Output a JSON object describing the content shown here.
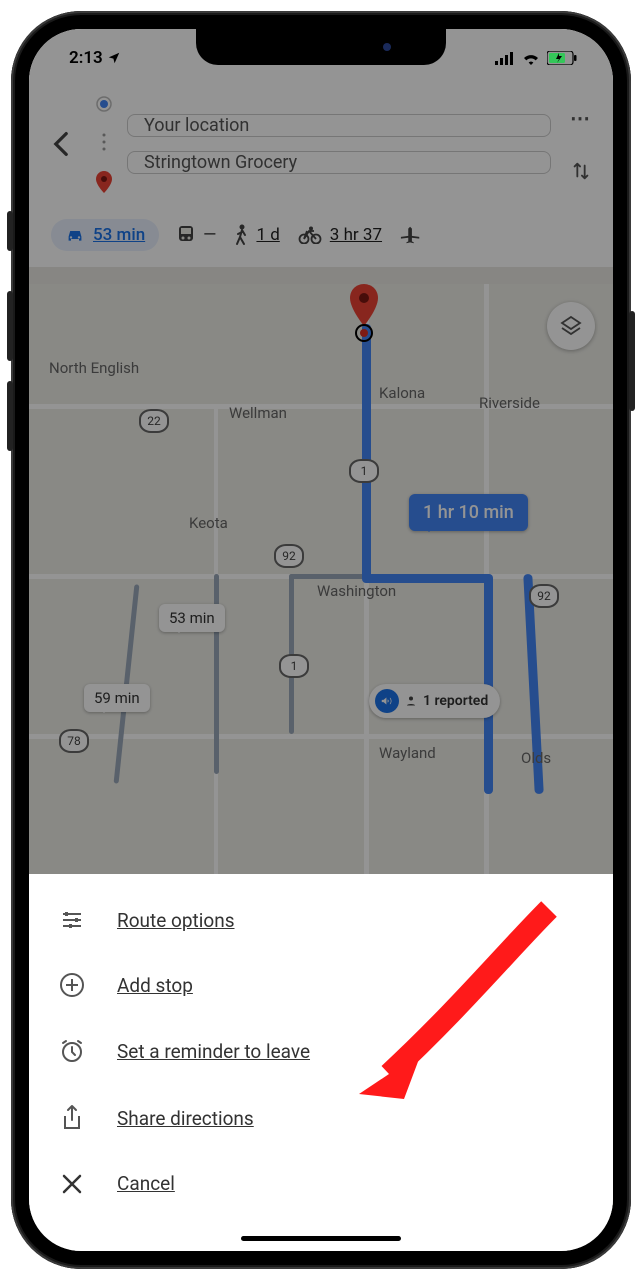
{
  "status": {
    "time": "2:13",
    "battery_charging": true
  },
  "header": {
    "origin": "Your location",
    "destination": "Stringtown Grocery"
  },
  "modes": {
    "drive": {
      "label": "53 min",
      "selected": true
    },
    "transit": {
      "label": "—"
    },
    "walk": {
      "label": "1 d"
    },
    "bike": {
      "label": "3 hr 37"
    }
  },
  "map": {
    "towns": {
      "north_english": "North English",
      "wellman": "Wellman",
      "kalona": "Kalona",
      "riverside": "Riverside",
      "keota": "Keota",
      "washington": "Washington",
      "wayland": "Wayland",
      "olds": "Olds"
    },
    "shields": {
      "r22": "22",
      "r1a": "1",
      "r1b": "1",
      "r92a": "92",
      "r92b": "92",
      "r78": "78"
    },
    "route_labels": {
      "primary": "1 hr 10 min",
      "alt1": "53 min",
      "alt2": "59 min"
    },
    "reported": "1 reported"
  },
  "sheet": {
    "items": [
      {
        "label": "Route options"
      },
      {
        "label": "Add stop"
      },
      {
        "label": "Set a reminder to leave"
      },
      {
        "label": "Share directions"
      },
      {
        "label": "Cancel"
      }
    ]
  }
}
